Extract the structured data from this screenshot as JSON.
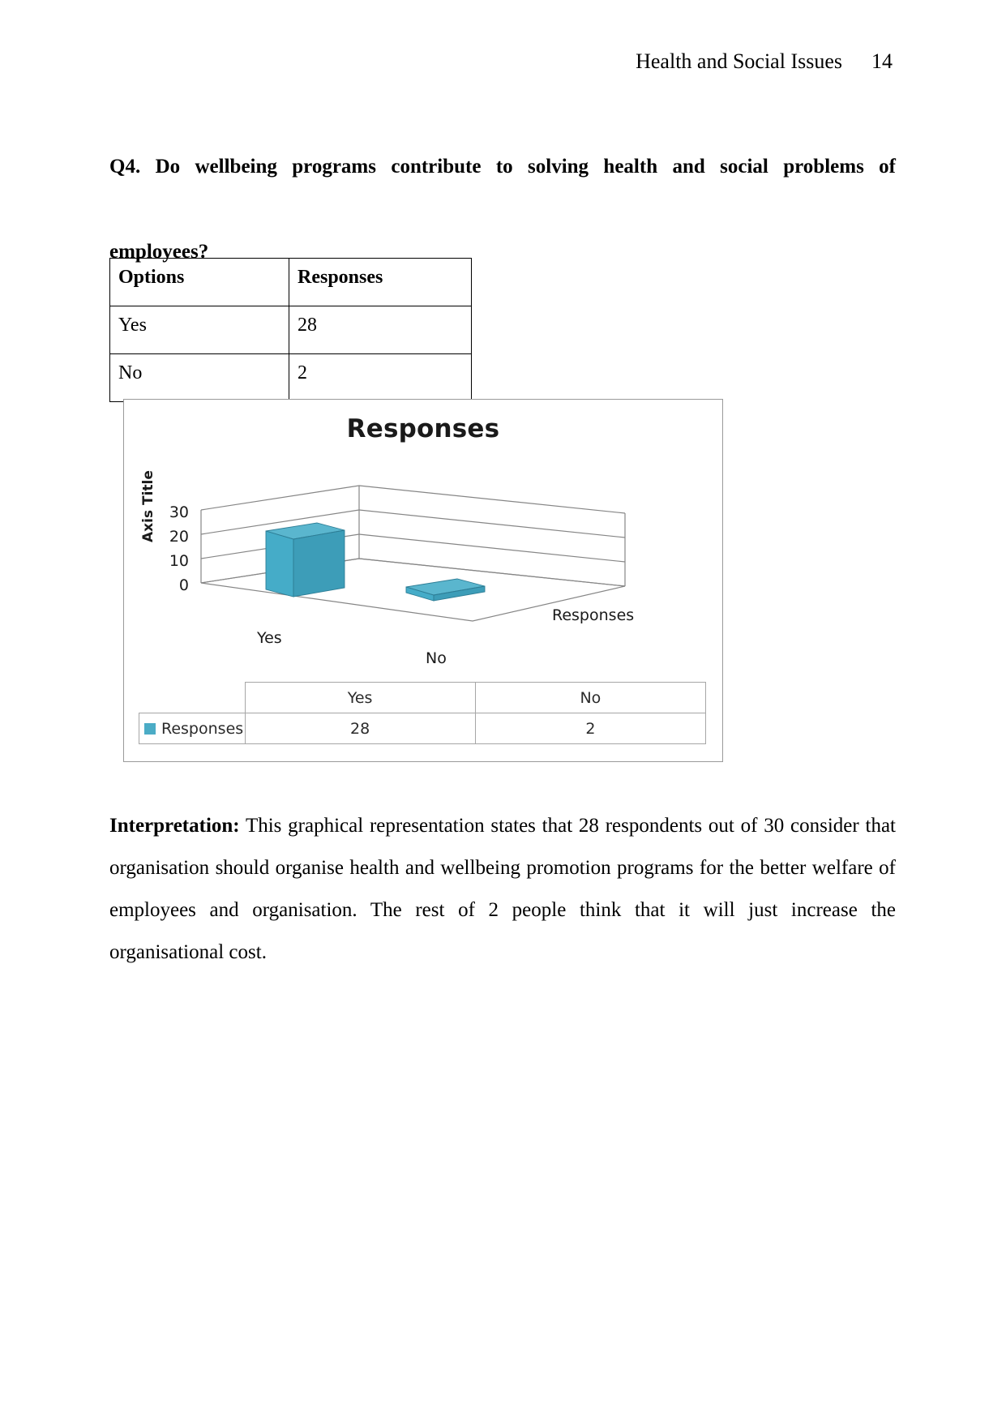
{
  "header": {
    "title": "Health and Social Issues",
    "page_number": "14"
  },
  "question": {
    "line1": "Q4. Do wellbeing programs contribute to solving health and social problems of",
    "line2": "employees?"
  },
  "options_table": {
    "columns": [
      "Options",
      "Responses"
    ],
    "rows": [
      {
        "option": "Yes",
        "responses": "28"
      },
      {
        "option": "No",
        "responses": "2"
      }
    ]
  },
  "chart": {
    "title": "Responses",
    "axis_title": "Axis Title",
    "depth_axis_label": "Responses",
    "y_ticks": [
      "30",
      "20",
      "10",
      "0"
    ],
    "categories": [
      "Yes",
      "No"
    ],
    "series_name": "Responses",
    "series_color": "#4BACC6",
    "data_table": {
      "col_headers": [
        "Yes",
        "No"
      ],
      "row_label": "Responses",
      "values": [
        "28",
        "2"
      ]
    }
  },
  "chart_data": {
    "type": "bar",
    "title": "Responses",
    "categories": [
      "Yes",
      "No"
    ],
    "series": [
      {
        "name": "Responses",
        "values": [
          28,
          2
        ]
      }
    ],
    "values": [
      28,
      2
    ],
    "xlabel": "",
    "ylabel": "Axis Title",
    "ylim": [
      0,
      30
    ],
    "yticks": [
      0,
      10,
      20,
      30
    ],
    "grid": true,
    "legend": "bottom-data-table",
    "style": "3d-column",
    "depth_axis_label": "Responses"
  },
  "interpretation": {
    "label": "Interpretation:",
    "text": " This graphical representation states that 28 respondents out of 30 consider that organisation should organise health and wellbeing promotion programs for the better welfare of employees and organisation. The rest of 2 people think that it will just increase the organisational cost."
  }
}
